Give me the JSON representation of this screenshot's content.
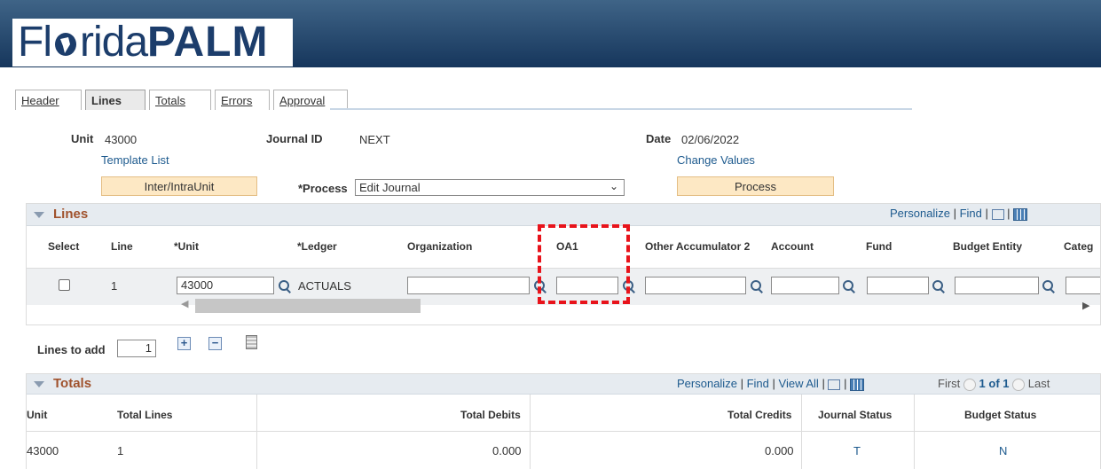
{
  "logo": {
    "part1": "Fl",
    "part2": "rida",
    "bold": "PALM"
  },
  "tabs": [
    {
      "label": "Header"
    },
    {
      "label": "Lines"
    },
    {
      "label": "Totals"
    },
    {
      "label": "Errors"
    },
    {
      "label": "Approval"
    }
  ],
  "header": {
    "unit_label": "Unit",
    "unit_value": "43000",
    "journal_label": "Journal ID",
    "journal_value": "NEXT",
    "date_label": "Date",
    "date_value": "02/06/2022",
    "template_link": "Template List",
    "change_values_link": "Change Values",
    "inter_button": "Inter/IntraUnit",
    "process_label": "*Process",
    "process_value": "Edit Journal",
    "process_button": "Process"
  },
  "lines": {
    "title": "Lines",
    "toolbar": {
      "personalize": "Personalize",
      "find": "Find",
      "sep": "|"
    },
    "columns": [
      "Select",
      "Line",
      "*Unit",
      "*Ledger",
      "Organization",
      "OA1",
      "Other Accumulator 2",
      "Account",
      "Fund",
      "Budget Entity",
      "Categ"
    ],
    "row": {
      "line": "1",
      "unit": "43000",
      "ledger": "ACTUALS"
    }
  },
  "lines_to_add": {
    "label": "Lines to add",
    "value": "1"
  },
  "totals": {
    "title": "Totals",
    "toolbar": {
      "personalize": "Personalize",
      "find": "Find",
      "view_all": "View All",
      "sep": "|"
    },
    "nav": {
      "first": "First",
      "range": "1 of 1",
      "last": "Last"
    },
    "columns": [
      "Unit",
      "Total Lines",
      "Total Debits",
      "Total Credits",
      "Journal Status",
      "Budget Status"
    ],
    "row": {
      "unit": "43000",
      "total_lines": "1",
      "debits": "0.000",
      "credits": "0.000",
      "journal_status": "T",
      "budget_status": "N"
    }
  },
  "colors": {
    "banner": "#1e4470",
    "link": "#1d5a8e",
    "section_title": "#a0522d",
    "highlight": "#e8131b"
  }
}
